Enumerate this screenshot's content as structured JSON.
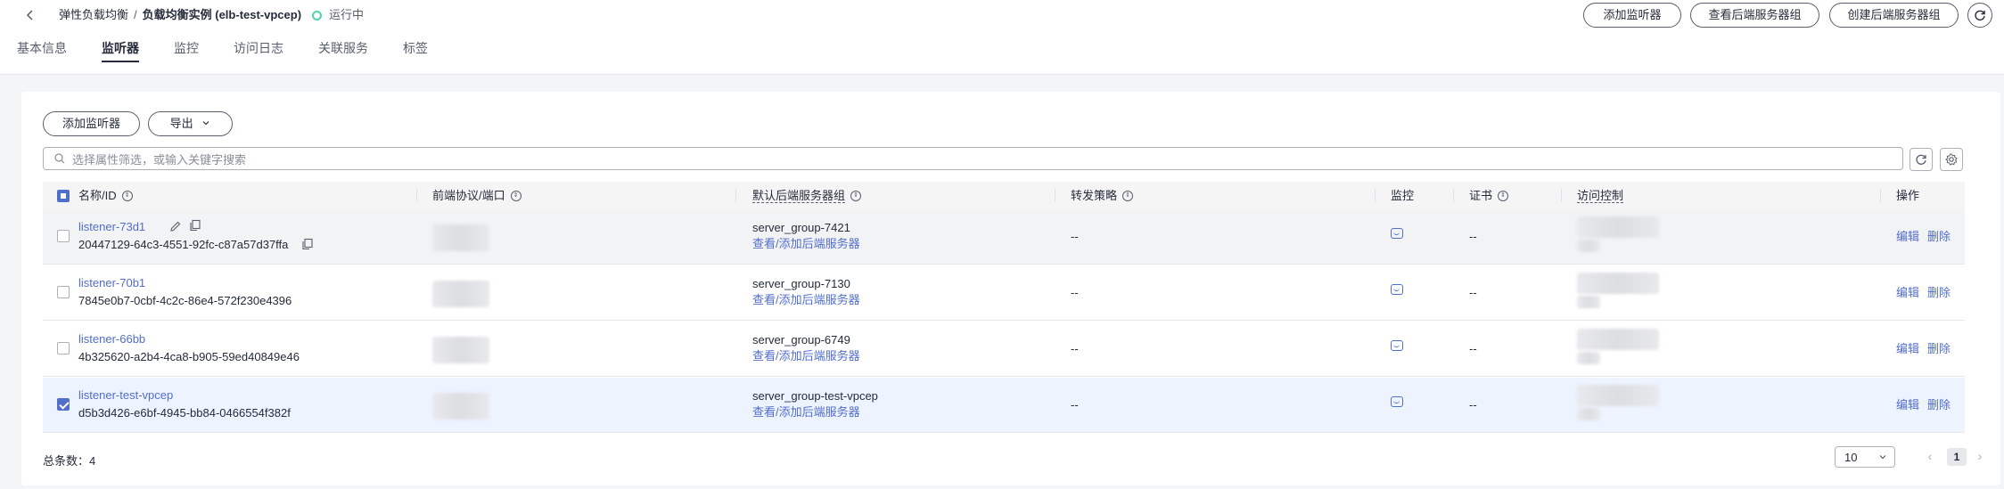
{
  "breadcrumb": {
    "parent": "弹性负载均衡",
    "separator": "/",
    "current": "负载均衡实例 (elb-test-vpcep)",
    "status": "运行中"
  },
  "header_buttons": {
    "add_listener": "添加监听器",
    "view_backend_group": "查看后端服务器组",
    "create_backend_group": "创建后端服务器组"
  },
  "tabs": [
    {
      "label": "基本信息",
      "active": false
    },
    {
      "label": "监听器",
      "active": true
    },
    {
      "label": "监控",
      "active": false
    },
    {
      "label": "访问日志",
      "active": false
    },
    {
      "label": "关联服务",
      "active": false
    },
    {
      "label": "标签",
      "active": false
    }
  ],
  "toolbar": {
    "add_listener": "添加监听器",
    "export": "导出",
    "search_placeholder": "选择属性筛选，或输入关键字搜索"
  },
  "table": {
    "headers": {
      "name": "名称/ID",
      "protocol": "前端协议/端口",
      "backend_group": "默认后端服务器组",
      "policy": "转发策略",
      "monitor": "监控",
      "cert": "证书",
      "access": "访问控制",
      "actions": "操作"
    },
    "rows": [
      {
        "name": "listener-73d1",
        "id": "20447129-64c3-4551-92fc-c87a57d37ffa",
        "backend_group": "server_group-7421",
        "backend_link": "查看/添加后端服务器",
        "policy": "--",
        "cert": "--",
        "edit": "编辑",
        "delete": "删除",
        "selected": false
      },
      {
        "name": "listener-70b1",
        "id": "7845e0b7-0cbf-4c2c-86e4-572f230e4396",
        "backend_group": "server_group-7130",
        "backend_link": "查看/添加后端服务器",
        "policy": "--",
        "cert": "--",
        "edit": "编辑",
        "delete": "删除",
        "selected": false
      },
      {
        "name": "listener-66bb",
        "id": "4b325620-a2b4-4ca8-b905-59ed40849e46",
        "backend_group": "server_group-6749",
        "backend_link": "查看/添加后端服务器",
        "policy": "--",
        "cert": "--",
        "edit": "编辑",
        "delete": "删除",
        "selected": false
      },
      {
        "name": "listener-test-vpcep",
        "id": "d5b3d426-e6bf-4945-bb84-0466554f382f",
        "backend_group": "server_group-test-vpcep",
        "backend_link": "查看/添加后端服务器",
        "policy": "--",
        "cert": "--",
        "edit": "编辑",
        "delete": "删除",
        "selected": true
      }
    ]
  },
  "footer": {
    "total": "总条数：4",
    "page_size": "10",
    "current_page": "1"
  },
  "colors": {
    "link": "#526ecc",
    "status": "#50d4ab"
  }
}
